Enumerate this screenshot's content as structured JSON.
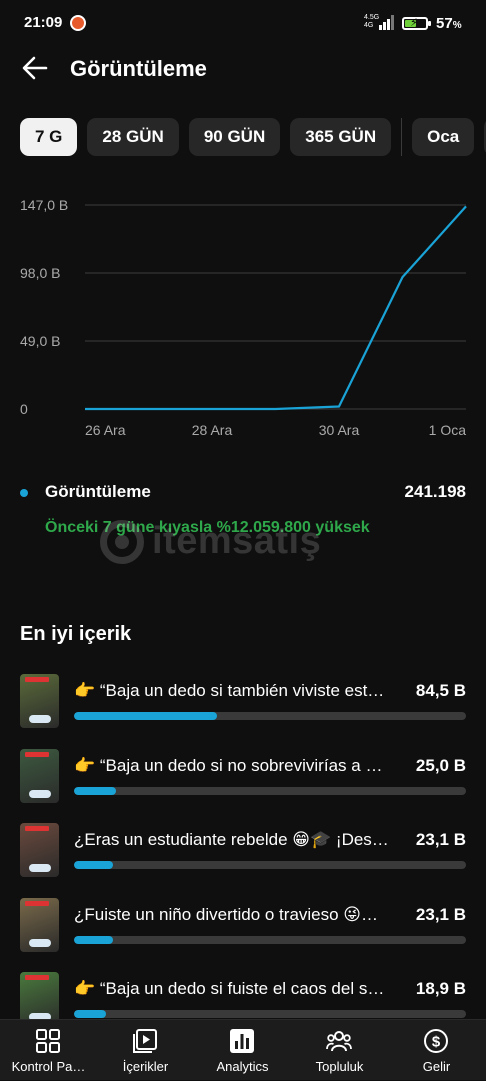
{
  "status_bar": {
    "time": "21:09",
    "network": "4.5G",
    "network_sub": "4G",
    "battery_level": 0.57,
    "battery_text": "57",
    "battery_unit": "%"
  },
  "header": {
    "title": "Görüntüleme"
  },
  "chips": [
    {
      "label": "7 G",
      "active": true
    },
    {
      "label": "28 GÜN",
      "active": false
    },
    {
      "label": "90 GÜN",
      "active": false
    },
    {
      "label": "365 GÜN",
      "active": false
    },
    {
      "label": "Oca",
      "active": false
    }
  ],
  "chart_data": {
    "type": "line",
    "y_ticks": [
      "147,0 B",
      "98,0 B",
      "49,0 B",
      "0"
    ],
    "y_tick_values": [
      147000,
      98000,
      49000,
      0
    ],
    "ylim": [
      0,
      147000
    ],
    "x_tick_labels": [
      "26 Ara",
      "28 Ara",
      "30 Ara",
      "1 Oca"
    ],
    "x": [
      "26 Ara",
      "27 Ara",
      "28 Ara",
      "29 Ara",
      "30 Ara",
      "31 Ara",
      "1 Oca"
    ],
    "series": [
      {
        "values": [
          0,
          0,
          0,
          0,
          1800,
          95000,
          146000
        ],
        "color": "#1aa3d6"
      }
    ],
    "grid": true
  },
  "metric": {
    "label": "Görüntüleme",
    "value": "241.198",
    "comparison": "Önceki 7 güne kıyasla %12.059.800 yüksek",
    "color": "#1aa3d6"
  },
  "watermark": {
    "text": "itemsatış"
  },
  "top_content": {
    "title": "En iyi içerik",
    "items": [
      {
        "title": "👉 “Baja un dedo si también viviste est…",
        "value": "84,5 B",
        "share": 0.365,
        "thumb_color": "#5b6b3a"
      },
      {
        "title": "👉 “Baja un dedo si no sobrevivirías a S…",
        "value": "25,0 B",
        "share": 0.108,
        "thumb_color": "#3d5a40"
      },
      {
        "title": "¿Eras un estudiante rebelde 😁🎓 ¡Des…",
        "value": "23,1 B",
        "share": 0.1,
        "thumb_color": "#6b4a3d"
      },
      {
        "title": "¿Fuiste un niño divertido o travieso 😜…",
        "value": "23,1 B",
        "share": 0.1,
        "thumb_color": "#7a6a4a"
      },
      {
        "title": "👉 “Baja un dedo si fuiste el caos del s…",
        "value": "18,9 B",
        "share": 0.082,
        "thumb_color": "#4a7a3d"
      }
    ]
  },
  "bottom_nav": [
    {
      "label": "Kontrol Pa…",
      "icon": "dashboard-icon"
    },
    {
      "label": "İçerikler",
      "icon": "content-icon"
    },
    {
      "label": "Analytics",
      "icon": "analytics-icon"
    },
    {
      "label": "Topluluk",
      "icon": "community-icon"
    },
    {
      "label": "Gelir",
      "icon": "earn-icon"
    }
  ]
}
